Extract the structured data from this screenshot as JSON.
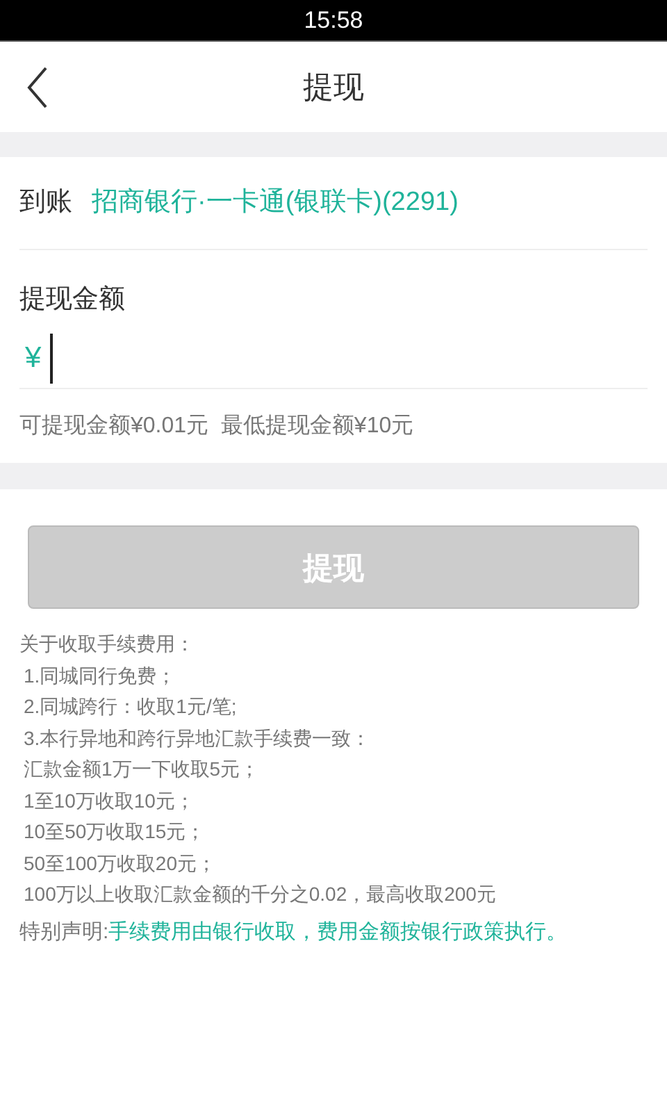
{
  "status_bar": {
    "time": "15:58"
  },
  "header": {
    "title": "提现"
  },
  "account": {
    "label": "到账",
    "value": "招商银行·一卡通(银联卡)(2291)"
  },
  "amount": {
    "label": "提现金额",
    "currency": "¥",
    "focused": true
  },
  "limits": "可提现金额¥0.01元  最低提现金额¥10元",
  "submit": {
    "label": "提现",
    "disabled": true
  },
  "notes": {
    "heading": "关于收取手续费用：",
    "items": [
      "1.同城同行免费；",
      "2.同城跨行：收取1元/笔;",
      "3.本行异地和跨行异地汇款手续费一致：",
      "汇款金额1万一下收取5元；",
      "1至10万收取10元；",
      "10至50万收取15元；",
      "50至100万收取20元；",
      "100万以上收取汇款金额的千分之0.02，最高收取200元"
    ]
  },
  "statement": {
    "label": "特别声明:",
    "text": "手续费用由银行收取，费用金额按银行政策执行。"
  }
}
